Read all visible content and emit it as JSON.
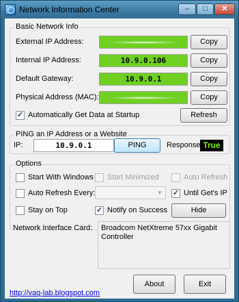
{
  "window": {
    "title": "Network Information Center",
    "minimize_glyph": "–",
    "maximize_glyph": "□",
    "close_glyph": "✕"
  },
  "basic": {
    "group_title": "Basic Network Info",
    "external_ip_label": "External IP Address:",
    "external_ip_value": "",
    "internal_ip_label": "Internal IP Address:",
    "internal_ip_value": "10.9.0.106",
    "gateway_label": "Default Gateway:",
    "gateway_value": "10.9.0.1",
    "mac_label": "Physical Address (MAC):",
    "mac_value": "",
    "copy_label": "Copy",
    "auto_get_label": "Automatically Get Data at Startup",
    "auto_get_checked": true,
    "refresh_label": "Refresh"
  },
  "ping": {
    "group_title": "PING an IP Address or a Website",
    "ip_label": "IP:",
    "ip_value": "10.9.0.1",
    "ping_button": "PING",
    "response_label": "Response:",
    "response_value": "True"
  },
  "options": {
    "group_title": "Options",
    "start_windows": "Start With Windows",
    "start_minimized": "Start Minimized",
    "auto_refresh": "Auto Refresh",
    "auto_refresh_every": "Auto Refresh Every:",
    "auto_refresh_every_value": "",
    "until_gets_ip": "Until Get's IP",
    "stay_on_top": "Stay on Top",
    "notify_on_success": "Notify on Success",
    "hide_button": "Hide",
    "check_glyph": "✓"
  },
  "nic": {
    "label": "Network Interface Card:",
    "value": "Broadcom NetXtreme 57xx Gigabit Controller"
  },
  "footer": {
    "link": "http://vaq-lab.blogspot.com",
    "about_button": "About",
    "exit_button": "Exit"
  },
  "colors": {
    "value_green": "#6fd022",
    "response_text": "#7cfc00",
    "title_bar": "#3b7aa3"
  }
}
